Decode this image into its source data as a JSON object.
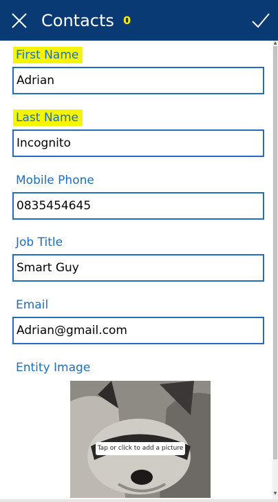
{
  "header": {
    "title": "Contacts",
    "count": "0",
    "icons": {
      "close": "close-icon",
      "confirm": "check-icon"
    },
    "colors": {
      "bar": "#0a3a73",
      "count": "#ffec00"
    }
  },
  "form": {
    "first_name": {
      "label": "First Name",
      "value": "Adrian",
      "highlighted": true
    },
    "last_name": {
      "label": "Last Name",
      "value": "Incognito",
      "highlighted": true
    },
    "mobile_phone": {
      "label": "Mobile Phone",
      "value": "0835454645"
    },
    "job_title": {
      "label": "Job Title",
      "value": "Smart Guy"
    },
    "email": {
      "label": "Email",
      "value": "Adrian@gmail.com"
    },
    "entity_image": {
      "label": "Entity Image",
      "placeholder": "Tap or click to add a picture"
    }
  },
  "colors": {
    "accent": "#1f6dbf",
    "highlight": "#f5f500"
  }
}
